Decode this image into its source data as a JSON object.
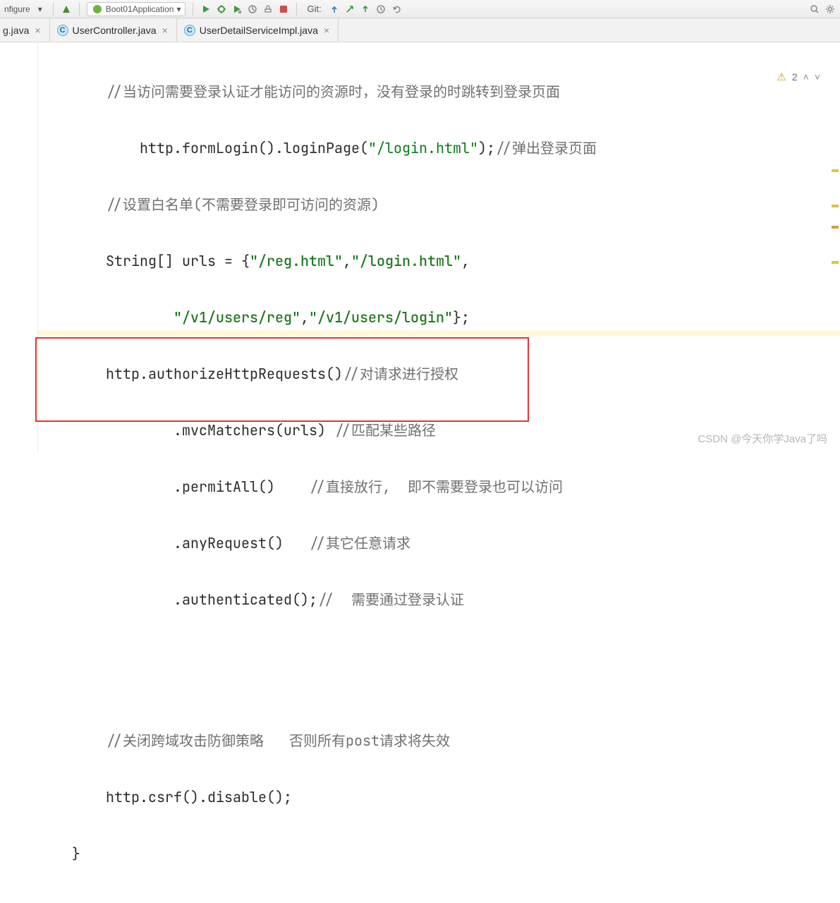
{
  "toolbar": {
    "configure_partial": "nfigure",
    "run_config": "Boot01Application",
    "git_label": "Git:"
  },
  "tabs": {
    "partial": "g.java",
    "items": [
      {
        "icon": "C",
        "label": "UserController.java"
      },
      {
        "icon": "C",
        "label": "UserDetailServiceImpl.java"
      }
    ]
  },
  "analysis": {
    "warn_count": "2"
  },
  "code": {
    "l1_comment": "//当访问需要登录认证才能访问的资源时，没有登录的时跳转到登录页面",
    "l2_a": "http.formLogin().loginPage(",
    "l2_str": "\"/login.html\"",
    "l2_b": ");",
    "l2_comment": "//弹出登录页面",
    "l3_comment": "//设置白名单(不需要登录即可访问的资源)",
    "l4_a": "String[] urls = {",
    "l4_s1": "\"/reg.html\"",
    "l4_c1": ",",
    "l4_s2": "\"/login.html\"",
    "l4_c2": ",",
    "l5_s1": "\"/v1/users/reg\"",
    "l5_c1": ",",
    "l5_s2": "\"/v1/users/login\"",
    "l5_end": "};",
    "l6_a": "http.authorizeHttpRequests()",
    "l6_comment": "//对请求进行授权",
    "l7_a": ".mvcMatchers(urls) ",
    "l7_comment": "//匹配某些路径",
    "l8_a": ".permitAll()    ",
    "l8_comment": "//直接放行,  即不需要登录也可以访问",
    "l9_a": ".anyRequest()   ",
    "l9_comment": "//其它任意请求",
    "l10_a": ".authenticated();",
    "l10_comment": "//  需要通过登录认证",
    "l12_comment": "//关闭跨域攻击防御策略   否则所有post请求将失效",
    "l13_a": "http.csrf().disable();",
    "l14": "}"
  },
  "watermark": "CSDN @今天你学Java了吗"
}
